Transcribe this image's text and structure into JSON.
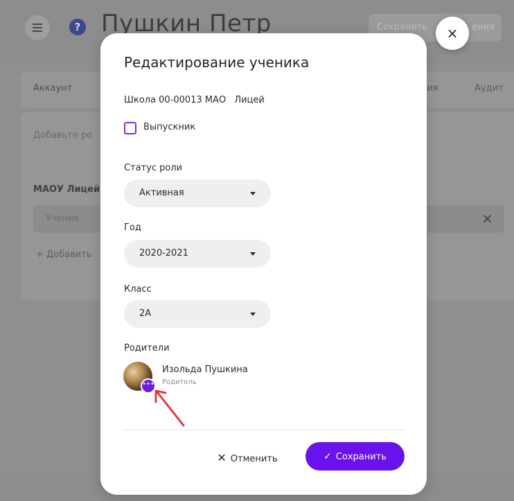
{
  "background": {
    "title": "Пушкин Петр",
    "save_label": "Сохранить",
    "save_suffix": "ения",
    "tabs": [
      "Аккаунт",
      "ния",
      "Аудит"
    ],
    "hint": "Добавьте ро",
    "org": "МАОУ Лицей",
    "role_value": "Ученик",
    "add_label": "+ Добавить"
  },
  "modal": {
    "title": "Редактирование ученика",
    "school_code": "Школа 00-00013 МАО",
    "school_name": "Лицей",
    "graduate_label": "Выпускник",
    "fields": [
      {
        "label": "Статус роли",
        "value": "Активная"
      },
      {
        "label": "Год",
        "value": "2020-2021"
      },
      {
        "label": "Класс",
        "value": "2А"
      }
    ],
    "parents_label": "Родители",
    "parent": {
      "name": "Изольда Пушкина",
      "role": "Родитель"
    },
    "cancel_label": "Отменить",
    "save_label": "Сохранить",
    "close_symbol": "×"
  },
  "colors": {
    "accent": "#6a12ee",
    "checkbox_border": "#7a2fd1",
    "arrow": "#e53935"
  },
  "icons": [
    "menu-icon",
    "help-icon",
    "check-icon",
    "close-icon",
    "caret-down-icon",
    "more-icon",
    "arrow-annotation-icon"
  ]
}
